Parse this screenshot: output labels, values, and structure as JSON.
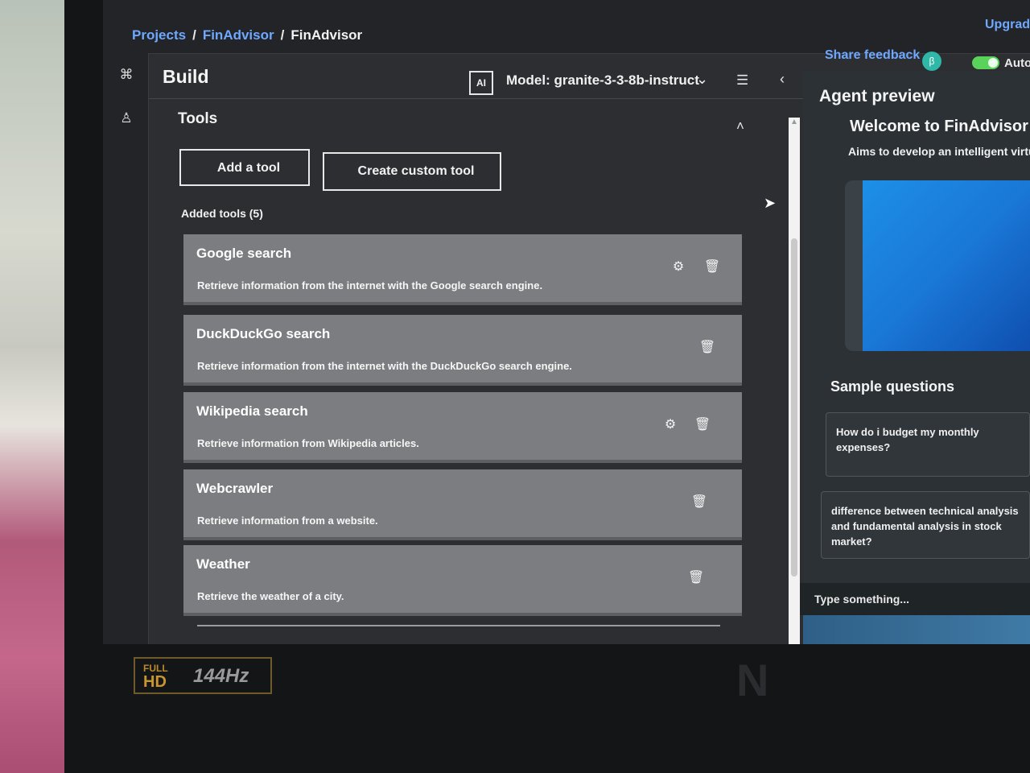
{
  "breadcrumb": {
    "projects": "Projects",
    "sep": "/",
    "app1": "FinAdvisor",
    "current": "FinAdvisor"
  },
  "header": {
    "upgrade": "Upgrad",
    "share_feedback": "Share feedback",
    "beta": "β",
    "auto_label": "Auto"
  },
  "build": {
    "title": "Build",
    "ai_badge": "AI",
    "model_label": "Model: granite-3-3-8b-instruct"
  },
  "tools": {
    "title": "Tools",
    "add_button": "Add a tool",
    "create_button": "Create custom tool",
    "added_label": "Added tools (5)",
    "items": [
      {
        "name": "Google search",
        "desc": "Retrieve information from the internet with the Google search engine."
      },
      {
        "name": "DuckDuckGo search",
        "desc": "Retrieve information from the internet with the DuckDuckGo search engine."
      },
      {
        "name": "Wikipedia search",
        "desc": "Retrieve information from Wikipedia articles."
      },
      {
        "name": "Webcrawler",
        "desc": "Retrieve information from a website."
      },
      {
        "name": "Weather",
        "desc": "Retrieve the weather of a city."
      }
    ]
  },
  "preview": {
    "title": "Agent preview",
    "welcome": "Welcome to FinAdvisor",
    "aims": "Aims to develop an intelligent virtu",
    "sample_title": "Sample questions",
    "questions": [
      "How do i budget my monthly expenses?",
      "difference between technical analysis and fundamental analysis in stock market?"
    ],
    "input_placeholder": "Type something..."
  },
  "hardware": {
    "full": "FULL",
    "hd": "HD",
    "hz": "144Hz"
  },
  "colors": {
    "link": "#6fa8ff",
    "toggle": "#5ad35a",
    "beta": "#2fb8a7"
  }
}
